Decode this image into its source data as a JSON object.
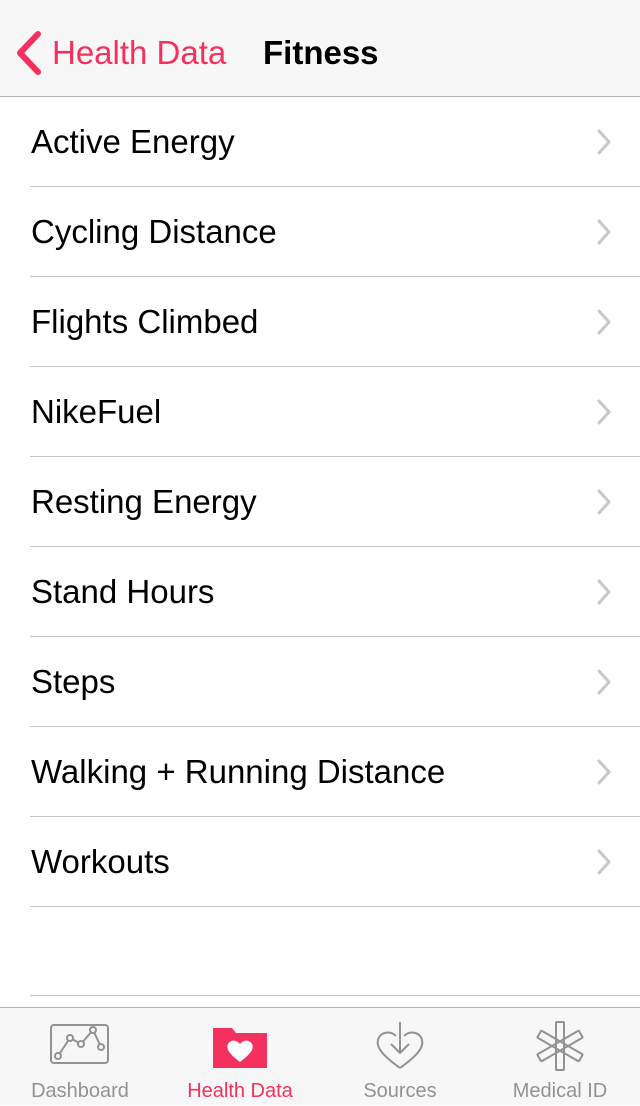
{
  "navbar": {
    "back_label": "Health Data",
    "title": "Fitness"
  },
  "list": {
    "items": [
      {
        "label": "Active Energy"
      },
      {
        "label": "Cycling Distance"
      },
      {
        "label": "Flights Climbed"
      },
      {
        "label": "NikeFuel"
      },
      {
        "label": "Resting Energy"
      },
      {
        "label": "Stand Hours"
      },
      {
        "label": "Steps"
      },
      {
        "label": "Walking + Running Distance"
      },
      {
        "label": "Workouts"
      }
    ]
  },
  "tabbar": {
    "tabs": [
      {
        "label": "Dashboard",
        "icon": "dashboard-chart-icon",
        "active": false
      },
      {
        "label": "Health Data",
        "icon": "health-data-folder-heart-icon",
        "active": true
      },
      {
        "label": "Sources",
        "icon": "sources-heart-download-icon",
        "active": false
      },
      {
        "label": "Medical ID",
        "icon": "medical-id-asterisk-icon",
        "active": false
      }
    ]
  },
  "colors": {
    "accent": "#f4305e",
    "inactive_tab": "#929292",
    "separator": "#c8c7cc",
    "chevron": "#c7c7cc",
    "bar_background": "#f7f7f7"
  }
}
